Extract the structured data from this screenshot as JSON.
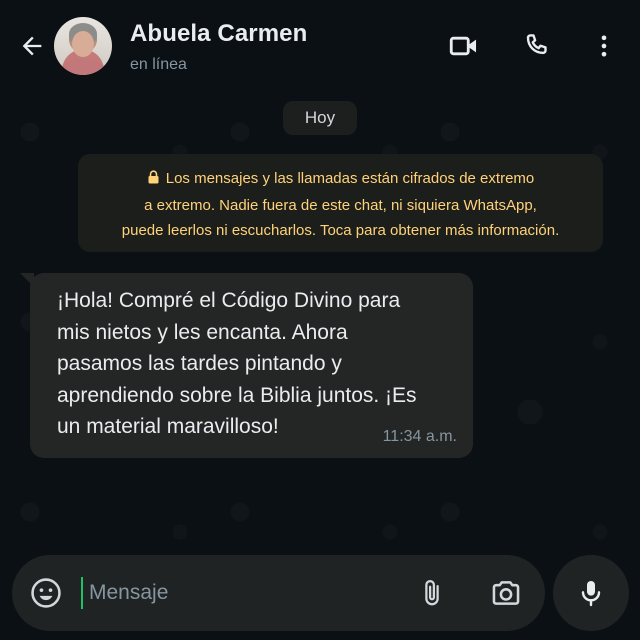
{
  "header": {
    "contact_name": "Abuela Carmen",
    "status": "en línea",
    "icons": [
      "back-arrow-icon",
      "video-call-icon",
      "voice-call-icon",
      "more-options-icon"
    ]
  },
  "chat": {
    "date_chip": "Hoy",
    "encryption_notice": {
      "line1": "Los mensajes y las llamadas están cifrados de extremo",
      "line2": "a extremo. Nadie fuera de este chat, ni siquiera WhatsApp,",
      "line3": "puede leerlos ni escucharlos. Toca para obtener más información.",
      "icon": "lock-icon"
    },
    "messages": [
      {
        "lines": [
          "¡Hola! Compré el Código Divino para",
          "mis nietos y les encanta. Ahora",
          "pasamos las tardes pintando y",
          "aprendiendo sobre la Biblia juntos. ¡Es",
          "un material maravilloso!"
        ],
        "time": "11:34 a.m."
      }
    ]
  },
  "composer": {
    "placeholder": "Mensaje",
    "value": "",
    "icons": [
      "emoji-icon",
      "attach-icon",
      "camera-icon",
      "mic-icon"
    ]
  },
  "colors": {
    "background": "#0b1014",
    "bubble": "#242626",
    "notice_text": "#ffd279",
    "accent_green": "#21c063",
    "muted_text": "#8696a0"
  }
}
